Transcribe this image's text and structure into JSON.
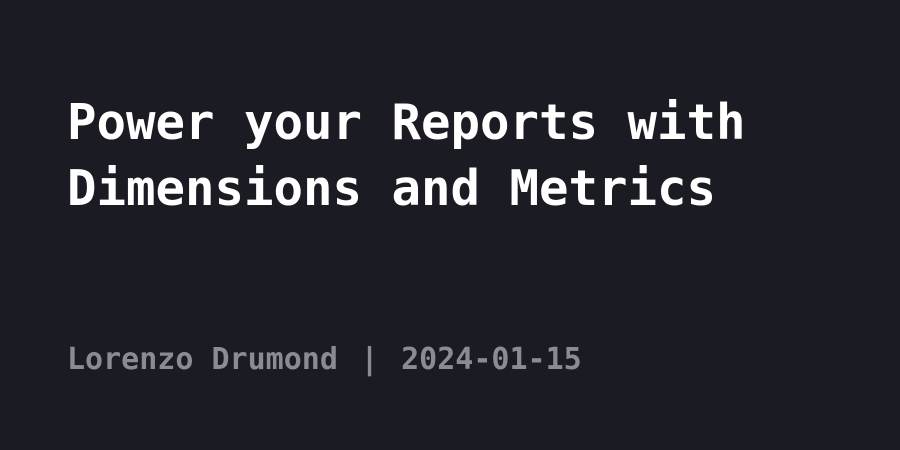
{
  "post": {
    "title": "Power your Reports with Dimensions and Metrics",
    "author": "Lorenzo Drumond",
    "separator": "|",
    "date": "2024-01-15"
  },
  "colors": {
    "background": "#1b1b23",
    "title": "#ffffff",
    "meta": "#8b8b94"
  }
}
